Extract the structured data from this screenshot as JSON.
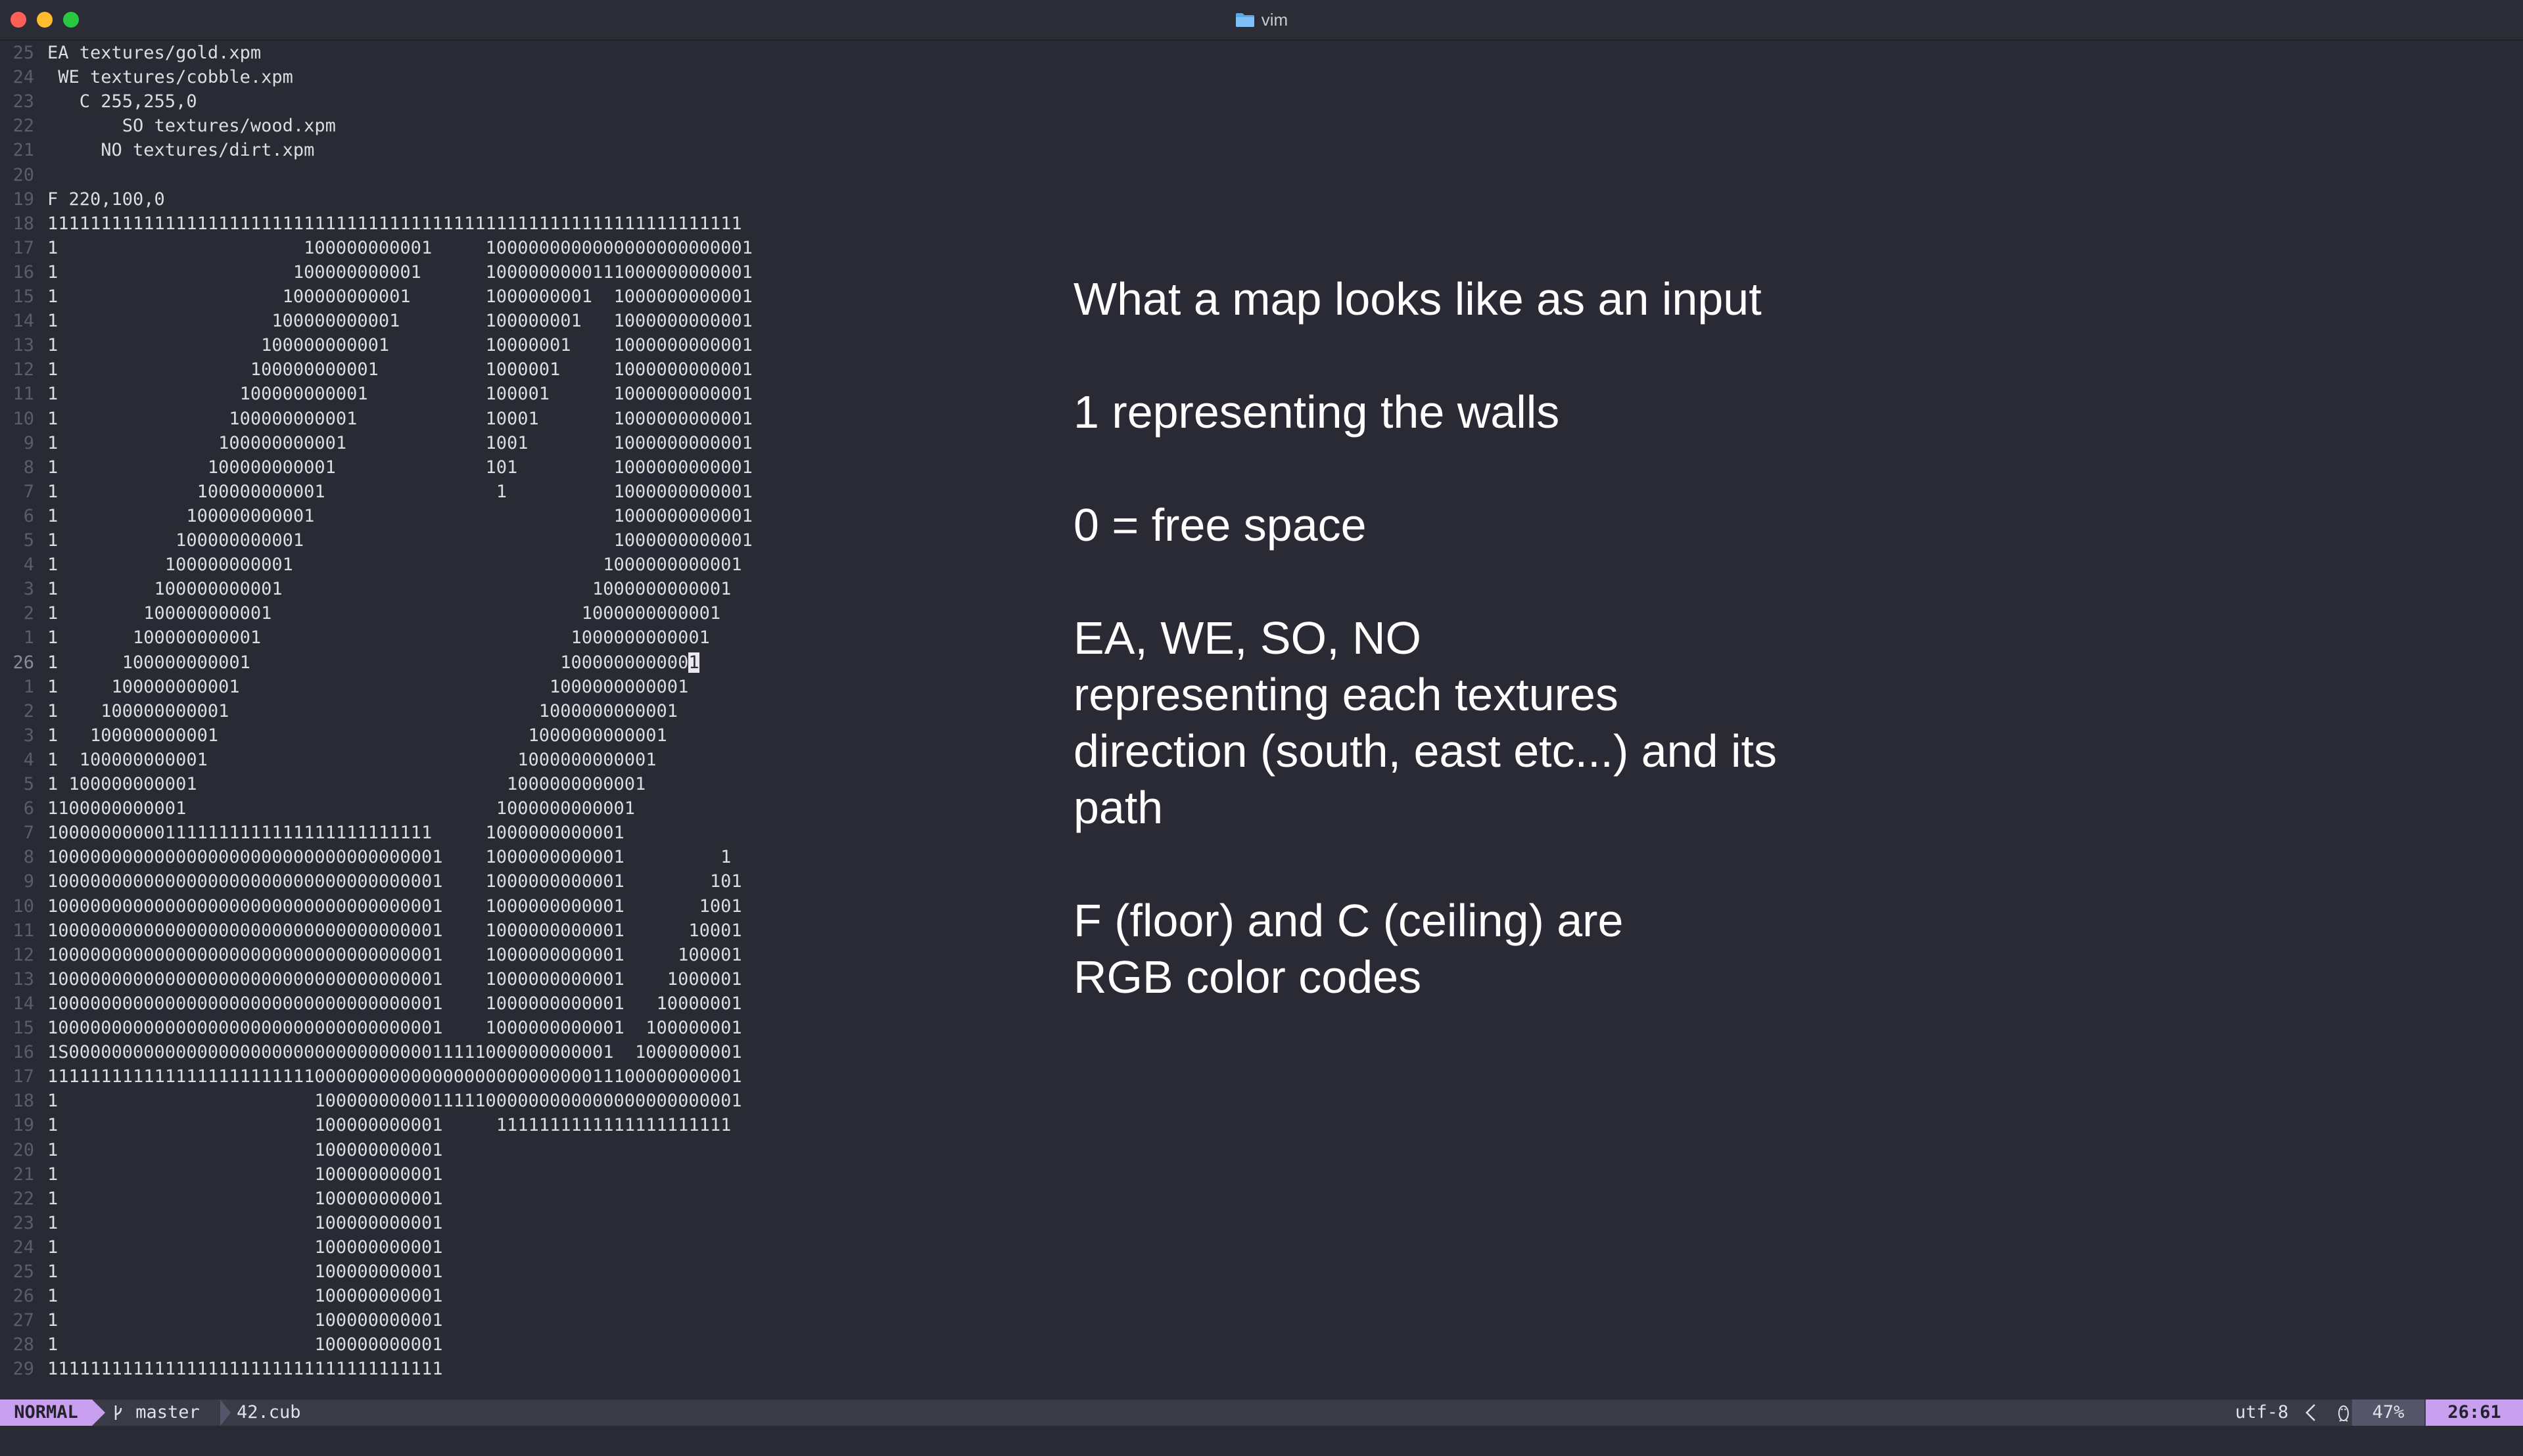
{
  "window": {
    "title": "vim",
    "title_icon": "folder-icon"
  },
  "editor": {
    "lines": [
      {
        "num": "25",
        "text": "EA textures/gold.xpm"
      },
      {
        "num": "24",
        "text": " WE textures/cobble.xpm"
      },
      {
        "num": "23",
        "text": "   C 255,255,0"
      },
      {
        "num": "22",
        "text": "       SO textures/wood.xpm"
      },
      {
        "num": "21",
        "text": "     NO textures/dirt.xpm"
      },
      {
        "num": "20",
        "text": ""
      },
      {
        "num": "19",
        "text": "F 220,100,0"
      },
      {
        "num": "18",
        "text": "11111111111111111111111111111111111111111111111111111111111111111"
      },
      {
        "num": "17",
        "text": "1                       100000000001     1000000000000000000000001"
      },
      {
        "num": "16",
        "text": "1                      100000000001      1000000000111000000000001"
      },
      {
        "num": "15",
        "text": "1                     100000000001       1000000001  1000000000001"
      },
      {
        "num": "14",
        "text": "1                    100000000001        100000001   1000000000001"
      },
      {
        "num": "13",
        "text": "1                   100000000001         10000001    1000000000001"
      },
      {
        "num": "12",
        "text": "1                  100000000001          1000001     1000000000001"
      },
      {
        "num": "11",
        "text": "1                 100000000001           100001      1000000000001"
      },
      {
        "num": "10",
        "text": "1                100000000001            10001       1000000000001"
      },
      {
        "num": "9",
        "text": "1               100000000001             1001        1000000000001"
      },
      {
        "num": "8",
        "text": "1              100000000001              101         1000000000001"
      },
      {
        "num": "7",
        "text": "1             100000000001                1          1000000000001"
      },
      {
        "num": "6",
        "text": "1            100000000001                            1000000000001"
      },
      {
        "num": "5",
        "text": "1           100000000001                             1000000000001"
      },
      {
        "num": "4",
        "text": "1          100000000001                             1000000000001"
      },
      {
        "num": "3",
        "text": "1         100000000001                             1000000000001"
      },
      {
        "num": "2",
        "text": "1        100000000001                             1000000000001"
      },
      {
        "num": "1",
        "text": "1       100000000001                             1000000000001"
      },
      {
        "num": "26",
        "text_before": "1      100000000001                             100000000000",
        "cursor_char": "1",
        "current": true
      },
      {
        "num": "1",
        "text": "1     100000000001                             1000000000001"
      },
      {
        "num": "2",
        "text": "1    100000000001                             1000000000001"
      },
      {
        "num": "3",
        "text": "1   100000000001                             1000000000001"
      },
      {
        "num": "4",
        "text": "1  100000000001                             1000000000001"
      },
      {
        "num": "5",
        "text": "1 100000000001                             1000000000001"
      },
      {
        "num": "6",
        "text": "1100000000001                             1000000000001"
      },
      {
        "num": "7",
        "text": "100000000001111111111111111111111111     1000000000001"
      },
      {
        "num": "8",
        "text": "1000000000000000000000000000000000001    1000000000001         1"
      },
      {
        "num": "9",
        "text": "1000000000000000000000000000000000001    1000000000001        101"
      },
      {
        "num": "10",
        "text": "1000000000000000000000000000000000001    1000000000001       1001"
      },
      {
        "num": "11",
        "text": "1000000000000000000000000000000000001    1000000000001      10001"
      },
      {
        "num": "12",
        "text": "1000000000000000000000000000000000001    1000000000001     100001"
      },
      {
        "num": "13",
        "text": "1000000000000000000000000000000000001    1000000000001    1000001"
      },
      {
        "num": "14",
        "text": "1000000000000000000000000000000000001    1000000000001   10000001"
      },
      {
        "num": "15",
        "text": "1000000000000000000000000000000000001    1000000000001  100000001"
      },
      {
        "num": "16",
        "text": "1S000000000000000000000000000000000011111000000000001  1000000001"
      },
      {
        "num": "17",
        "text": "11111111111111111111111110000000000000000000000000011100000000001"
      },
      {
        "num": "18",
        "text": "1                        1000000000011111000000000000000000000001"
      },
      {
        "num": "19",
        "text": "1                        100000000001     1111111111111111111111"
      },
      {
        "num": "20",
        "text": "1                        100000000001"
      },
      {
        "num": "21",
        "text": "1                        100000000001"
      },
      {
        "num": "22",
        "text": "1                        100000000001"
      },
      {
        "num": "23",
        "text": "1                        100000000001"
      },
      {
        "num": "24",
        "text": "1                        100000000001"
      },
      {
        "num": "25",
        "text": "1                        100000000001"
      },
      {
        "num": "26",
        "text": "1                        100000000001"
      },
      {
        "num": "27",
        "text": "1                        100000000001"
      },
      {
        "num": "28",
        "text": "1                        100000000001"
      },
      {
        "num": "29",
        "text": "1111111111111111111111111111111111111"
      }
    ]
  },
  "notes": {
    "p1": "What a map looks like as an input",
    "p2": "1 representing the walls",
    "p3": "0 = free space",
    "p4a": "EA, WE, SO, NO",
    "p4b": "representing each textures",
    "p4c": "direction (south, east etc...) and its",
    "p4d": "path",
    "p5a": "F (floor) and C (ceiling) are",
    "p5b": "RGB color codes"
  },
  "statusbar": {
    "mode": "NORMAL",
    "branch_icon": "git-branch-icon",
    "branch": "master",
    "file": "42.cub",
    "encoding": "utf-8",
    "os_icon": "linux-penguin-icon",
    "percent": "47%",
    "position": "26:61"
  },
  "colors": {
    "background": "#2a2a35",
    "text": "#dcdce4",
    "line_number": "#5c5c6b",
    "mode_accent": "#c9a0f0"
  }
}
